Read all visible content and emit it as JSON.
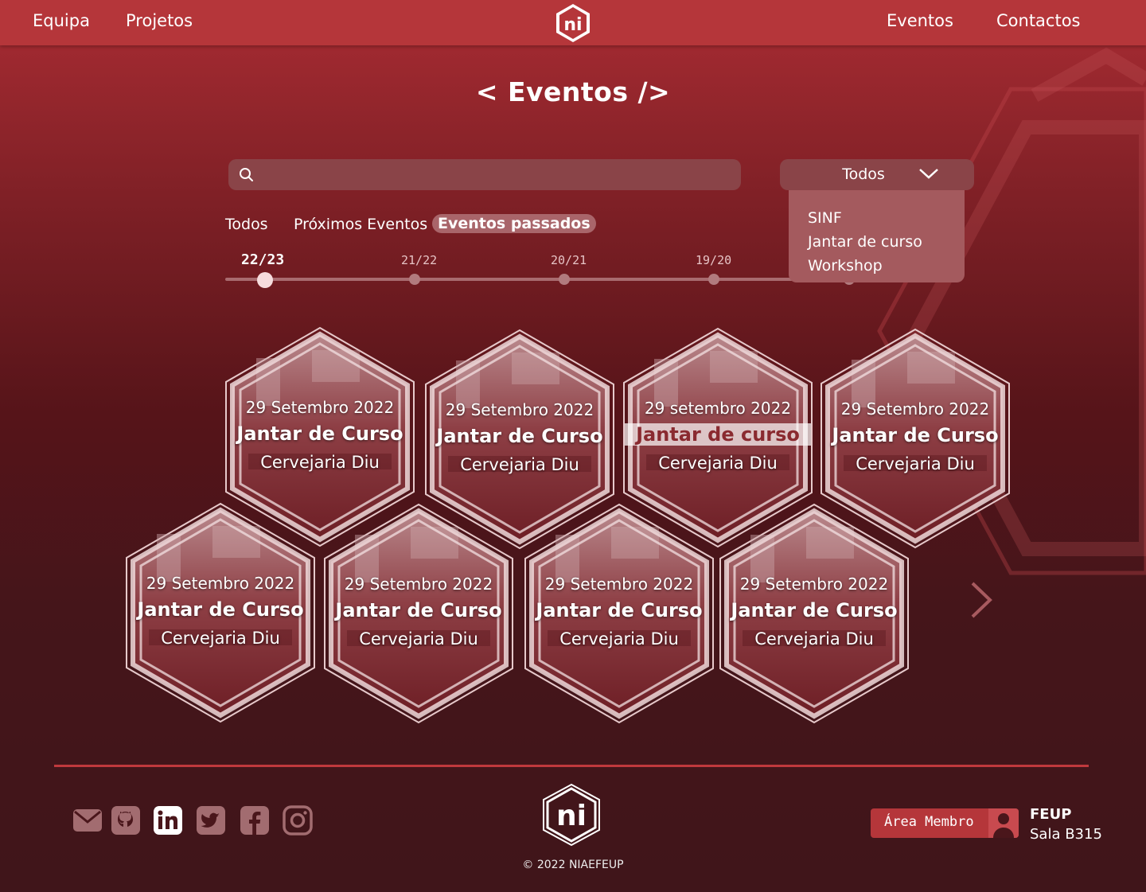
{
  "nav": {
    "left_links": [
      "Equipa",
      "Projetos"
    ],
    "right_links": [
      "Eventos",
      "Contactos"
    ],
    "logo_text": "ni"
  },
  "page": {
    "title": "< Eventos />"
  },
  "search": {
    "placeholder": "",
    "value": ""
  },
  "filter": {
    "selected": "Todos",
    "options": [
      "SINF",
      "Jantar de curso",
      "Workshop"
    ]
  },
  "tabs": [
    "Todos",
    "Próximos Eventos",
    "Eventos passados"
  ],
  "active_tab": "Eventos passados",
  "timeline": {
    "years": [
      "22/23",
      "21/22",
      "20/21",
      "19/20"
    ],
    "active": "22/23"
  },
  "events": [
    {
      "date": "29 Setembro 2022",
      "name": "Jantar de Curso",
      "place": "Cervejaria Diu"
    },
    {
      "date": "29 Setembro 2022",
      "name": "Jantar de Curso",
      "place": "Cervejaria Diu"
    },
    {
      "date": "29 setembro 2022",
      "name": "Jantar de curso",
      "place": "Cervejaria Diu"
    },
    {
      "date": "29 Setembro 2022",
      "name": "Jantar de Curso",
      "place": "Cervejaria Diu"
    },
    {
      "date": "29 Setembro 2022",
      "name": "Jantar de Curso",
      "place": "Cervejaria Diu"
    },
    {
      "date": "29 Setembro 2022",
      "name": "Jantar de Curso",
      "place": "Cervejaria Diu"
    },
    {
      "date": "29 Setembro 2022",
      "name": "Jantar de Curso",
      "place": "Cervejaria Diu"
    },
    {
      "date": "29 Setembro 2022",
      "name": "Jantar de Curso",
      "place": "Cervejaria Diu"
    }
  ],
  "footer": {
    "socials": [
      "mail-icon",
      "github-icon",
      "linkedin-icon",
      "twitter-icon",
      "facebook-icon",
      "instagram-icon"
    ],
    "copyright": "© 2022 NIAEFEUP",
    "member_button": "Área Membro",
    "address_line1": "FEUP",
    "address_line2": "Sala B315"
  },
  "colors": {
    "nav": "#b5363a",
    "accent": "#c0393d",
    "background_top": "#a92c33",
    "background_bottom": "#40151a"
  }
}
